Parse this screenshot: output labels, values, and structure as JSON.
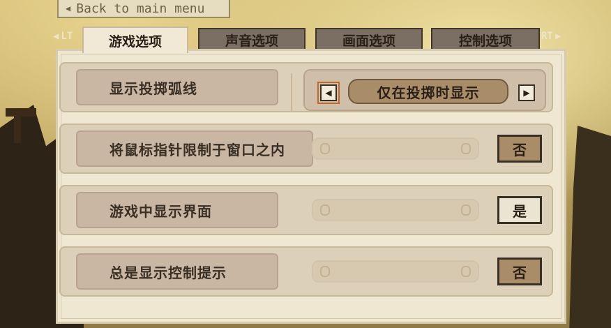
{
  "back_button": {
    "label": "Back to main menu"
  },
  "shoulders": {
    "left": "LT",
    "right": "RT"
  },
  "tabs": [
    {
      "label": "游戏选项",
      "active": true
    },
    {
      "label": "声音选项",
      "active": false
    },
    {
      "label": "画面选项",
      "active": false
    },
    {
      "label": "控制选项",
      "active": false
    }
  ],
  "settings": [
    {
      "label": "显示投掷弧线",
      "type": "selector",
      "value": "仅在投掷时显示"
    },
    {
      "label": "将鼠标指针限制于窗口之内",
      "type": "toggle",
      "value": "否"
    },
    {
      "label": "游戏中显示界面",
      "type": "toggle",
      "value": "是"
    },
    {
      "label": "总是显示控制提示",
      "type": "toggle",
      "value": "否"
    }
  ],
  "icons": {
    "back": "triangle-left-icon",
    "selector_prev": "triangle-left-icon",
    "selector_next": "triangle-right-icon"
  },
  "colors": {
    "panel": "#efe7d2",
    "active_tab": "#f1e9d6",
    "inactive_tab": "#7b6e62",
    "toggle_off": "#a98c68",
    "toggle_on": "#ece4d2"
  }
}
